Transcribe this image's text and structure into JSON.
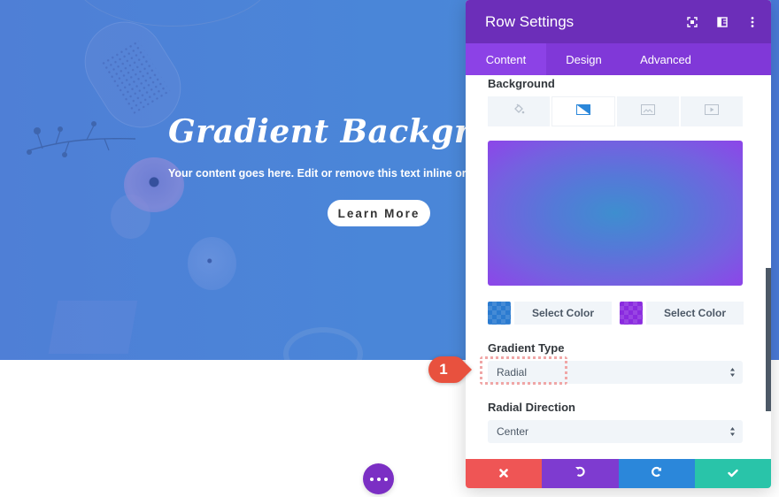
{
  "hero": {
    "title": "Gradient Background f",
    "text": "Your content goes here. Edit or remove this text inline or in the",
    "button_label": "Learn More"
  },
  "panel": {
    "title": "Row Settings",
    "header_icons": [
      "fullscreen-icon",
      "split-view-icon",
      "more-vertical-icon"
    ],
    "tabs": [
      {
        "label": "Content",
        "active": true
      },
      {
        "label": "Design",
        "active": false
      },
      {
        "label": "Advanced",
        "active": false
      }
    ],
    "background": {
      "label": "Background",
      "type_tabs": [
        {
          "icon": "paint-bucket-icon",
          "active": false
        },
        {
          "icon": "gradient-icon",
          "active": true
        },
        {
          "icon": "image-icon",
          "active": false
        },
        {
          "icon": "video-icon",
          "active": false
        }
      ],
      "gradient_start_color": "#2b7bd0",
      "gradient_end_color": "#8a2bdf",
      "select_color_label_1": "Select Color",
      "select_color_label_2": "Select Color"
    },
    "gradient_type": {
      "label": "Gradient Type",
      "value": "Radial"
    },
    "radial_direction": {
      "label": "Radial Direction",
      "value": "Center"
    },
    "footer": {
      "cancel": "close-icon",
      "undo": "undo-icon",
      "redo": "redo-icon",
      "save": "check-icon"
    }
  },
  "callout": {
    "number": "1"
  },
  "colors": {
    "header": "#6c2eb9",
    "tabs": "#8038d8",
    "cancel": "#ef5555",
    "undo": "#7e3bd0",
    "redo": "#2b87da",
    "save": "#29c4a9",
    "callout": "#e8513e"
  }
}
